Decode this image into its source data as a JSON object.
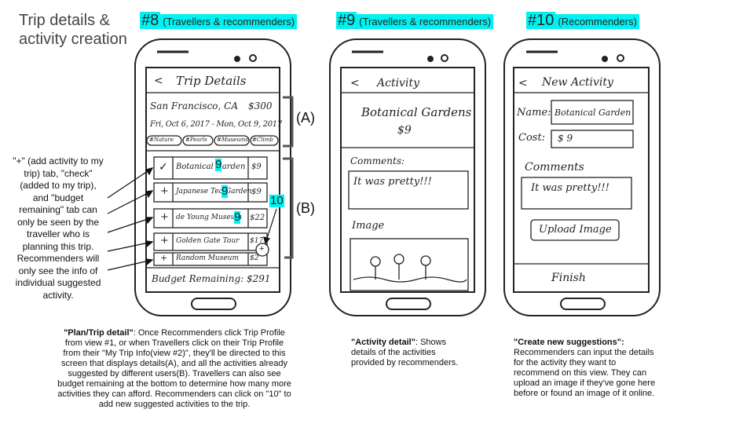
{
  "slide_title": "Trip details & activity creation",
  "views": [
    {
      "num": "#8",
      "audience": "(Travellers & recommenders)"
    },
    {
      "num": "#9",
      "audience": "(Travellers & recommenders)"
    },
    {
      "num": "#10",
      "audience": "(Recommenders)"
    }
  ],
  "phone8": {
    "back": "<",
    "title": "Trip Details",
    "location": "San Francisco, CA",
    "price": "$300",
    "dates": "Fri, Oct 6, 2017 - Mon, Oct 9, 2017",
    "tags": [
      "#Nature",
      "#Pearls",
      "#Museums",
      "#Climb"
    ],
    "activities": [
      {
        "mark": "✓",
        "name": "Botanical Garden",
        "cost": "$9"
      },
      {
        "mark": "+",
        "name": "Japanese Tea Garden",
        "cost": "$9"
      },
      {
        "mark": "+",
        "name": "de Young Museum",
        "cost": "$22"
      },
      {
        "mark": "+",
        "name": "Golden Gate Tour",
        "cost": "$17"
      },
      {
        "mark": "+",
        "name": "Random Museum",
        "cost": "$2"
      }
    ],
    "ref_nine": "9",
    "ref_ten": "10",
    "add": "+",
    "budget": "Budget Remaining: $291"
  },
  "phone9": {
    "back": "<",
    "title": "Activity",
    "name": "Botanical Gardens",
    "cost": "$9",
    "comments_label": "Comments:",
    "comment": "It was pretty!!!",
    "image_label": "Image"
  },
  "phone10": {
    "back": "<",
    "title": "New Activity",
    "name_label": "Name:",
    "name_value": "Botanical Garden",
    "cost_label": "Cost:",
    "cost_value": "$ 9",
    "comments_label": "Comments",
    "comment": "It was pretty!!!",
    "upload": "Upload Image",
    "finish": "Finish"
  },
  "labels": {
    "a": "(A)",
    "b": "(B)",
    "ten": "10"
  },
  "side_note": "\"+\" (add activity to my trip) tab, \"check\" (added to my trip), and \"budget remaining\" tab can only be seen by the traveller who is planning this trip. Recommenders will only see the info of individual suggested activity.",
  "captions": {
    "c8_title": "\"Plan/Trip detail\"",
    "c8_body": ": Once Recommenders click Trip Profile from view #1, or when Travellers click on their Trip Profile from their \"My Trip Info(view #2)\", they'll be directed to this screen that displays details(A), and all the activities already suggested by different users(B). Travellers can also see budget remaining at the bottom to determine how many more activities they can afford. Recommenders can click on \"10\" to add new suggested activities to the trip.",
    "c9_title": "\"Activity detail\"",
    "c9_body": ": Shows details of the activities provided by recommenders.",
    "c10_title": "\"Create new suggestions\":",
    "c10_body": "Recommenders can input the details for the activity they want to recommend on this view. They can upload an image if they've gone here before or found an image of it online."
  }
}
